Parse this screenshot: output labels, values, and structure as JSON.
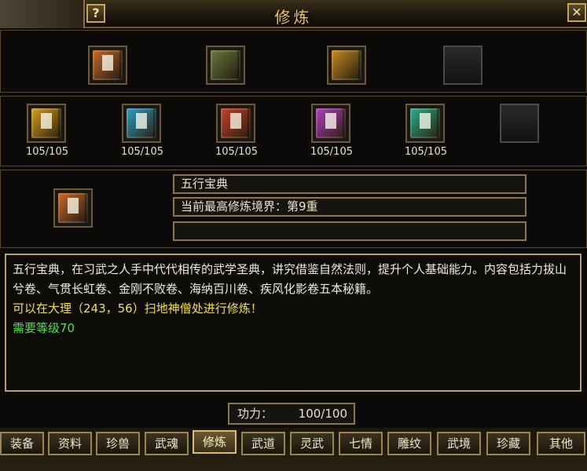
{
  "window": {
    "title": "修炼",
    "help_glyph": "?",
    "close_glyph": "✕"
  },
  "top_items": [
    {
      "icon": "cultivation-book-icon",
      "color": "#c96a2a"
    },
    {
      "icon": "scroll-bundle-icon",
      "color": "#6b7a3a"
    },
    {
      "icon": "gold-scroll-icon",
      "color": "#c98a20"
    },
    {
      "icon": "empty-slot-icon",
      "color": "#222222"
    }
  ],
  "manuals": [
    {
      "count": "105/105",
      "color": "#d9a020"
    },
    {
      "count": "105/105",
      "color": "#2aa0c8"
    },
    {
      "count": "105/105",
      "color": "#c8402a"
    },
    {
      "count": "105/105",
      "color": "#b040c0"
    },
    {
      "count": "105/105",
      "color": "#2ab08a"
    },
    {
      "count": "",
      "color": "#222222"
    }
  ],
  "selected": {
    "name": "五行宝典",
    "realm": "当前最高修炼境界：第9重",
    "extra": ""
  },
  "description": {
    "body": "五行宝典，在习武之人手中代代相传的武学圣典，讲究借鉴自然法则，提升个人基础能力。内容包括力拔山兮卷、气贯长虹卷、金刚不败卷、海纳百川卷、疾风化影卷五本秘籍。",
    "location": "可以在大理（243，56）扫地神僧处进行修炼！",
    "requirement": "需要等级70"
  },
  "power": {
    "label": "功力：",
    "value": "100/100"
  },
  "tabs": [
    "装备",
    "资料",
    "珍兽",
    "武魂",
    "修炼",
    "武道",
    "灵武",
    "七情",
    "雕纹",
    "武境",
    "珍藏",
    "其他"
  ],
  "active_tab": "修炼"
}
